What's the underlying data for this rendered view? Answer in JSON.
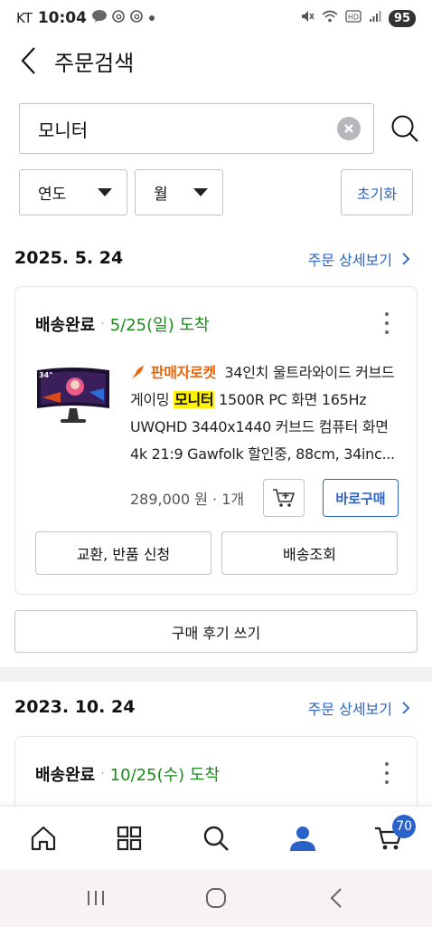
{
  "status_bar": {
    "carrier": "KT",
    "time": "10:04",
    "notif_icons": [
      "talk-icon",
      "threads-icon",
      "threads-icon",
      "dot-icon"
    ],
    "right_icons": [
      "mute-icon",
      "wifi-icon",
      "hd-icon",
      "signal-icon"
    ],
    "battery": "95"
  },
  "header": {
    "title": "주문검색"
  },
  "search": {
    "value": "모니터",
    "placeholder": ""
  },
  "filters": {
    "year_label": "연도",
    "month_label": "월",
    "reset_label": "초기화"
  },
  "colors": {
    "accent": "#2a62c9",
    "arrival_green": "#1a8a1a",
    "rocket_orange": "#e8660c",
    "highlight": "#fff200"
  },
  "orders": [
    {
      "date": "2025. 5. 24",
      "detail_link": "주문 상세보기",
      "status": "배송완료",
      "arrival": "5/25(일) 도착",
      "badge": "판매자로켓",
      "title_before": "34인치 울트라와이드 커브드 게이밍",
      "title_highlight": "모니터",
      "title_after": "1500R PC 화면 165Hz UWQHD 3440x1440 커브드 컴퓨터 화면 4k 21:9 Gawfolk 할인중, 88cm, 34inc...",
      "price_qty": "289,000 원 · 1개",
      "buy_label": "바로구매",
      "exchange_label": "교환, 반품 신청",
      "tracking_label": "배송조회",
      "review_label": "구매 후기 쓰기"
    },
    {
      "date": "2023. 10. 24",
      "detail_link": "주문 상세보기",
      "status": "배송완료",
      "arrival": "10/25(수) 도착"
    }
  ],
  "bottom_nav": {
    "items": [
      "home-icon",
      "category-icon",
      "search-icon",
      "mypage-icon",
      "cart-icon"
    ],
    "cart_count": "70"
  },
  "system_nav": [
    "recents-icon",
    "home-circle-icon",
    "back-icon"
  ]
}
